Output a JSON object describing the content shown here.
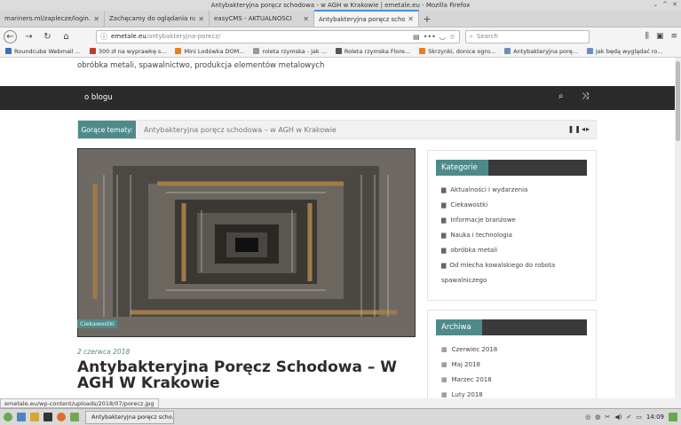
{
  "window": {
    "title": "Antybakteryjna poręcz schodowa - w AGH w Krakowie | emetale.eu - Mozilla Firefox"
  },
  "tabs": [
    {
      "label": "marinero.ml/zaplecze/login.php",
      "active": false
    },
    {
      "label": "Zachęcamy do oglądania naszej",
      "active": false
    },
    {
      "label": "easyCMS - AKTUALNOŚCI",
      "active": false
    },
    {
      "label": "Antybakteryjna poręcz schodowa",
      "active": true
    }
  ],
  "navbar": {
    "url_domain": "emetale.eu",
    "url_path": "/antybakteryjna-porecz/",
    "search_placeholder": "Search"
  },
  "bookmarks": [
    {
      "label": "Roundcube Webmail ...",
      "color": "#3a6fb5"
    },
    {
      "label": "300 zł na wyprawkę s...",
      "color": "#c0392b"
    },
    {
      "label": "Mini Lodówka DOM...",
      "color": "#e67e22"
    },
    {
      "label": "roleta rzymska - jak ...",
      "color": "#999999"
    },
    {
      "label": "Roleta rzymska Flore...",
      "color": "#555555"
    },
    {
      "label": "Skrzynki, donice ogro...",
      "color": "#e67e22"
    },
    {
      "label": "Antybakteryjna porę...",
      "color": "#6c8ebf"
    },
    {
      "label": "Jak będą wyglądać ro...",
      "color": "#6c8ebf"
    }
  ],
  "page": {
    "tagline": "obróbka metali, spawalnictwo, produkcja elementów metalowych",
    "menu_item": "o blogu",
    "hot_label": "Gorące tematy:",
    "hot_text": "Antybakteryjna poręcz schodowa – w AGH w Krakowie",
    "category_badge": "Ciekawostki",
    "post_date": "2 czerwca 2018",
    "post_title": "Antybakteryjna Poręcz Schodowa – W AGH W Krakowie"
  },
  "sidebar": {
    "categories_title": "Kategorie",
    "categories": [
      "Aktualności i wydarzenia",
      "Ciekawostki",
      "Informacje branżowe",
      "Nauka i technologia",
      "obróbka metali",
      "Od miecha kowalskiego do robota spawalniczego"
    ],
    "archive_title": "Archiwa",
    "archive": [
      "Czerwiec 2018",
      "Maj 2018",
      "Marzec 2018",
      "Luty 2018"
    ]
  },
  "status": {
    "url": "emetale.eu/wp-content/uploads/2018/07/porecz.jpg"
  },
  "taskbar": {
    "task_label": "Antybakteryjna poręcz scho...",
    "clock": "14:09"
  },
  "colors": {
    "accent": "#4f8a8b",
    "nav_dark": "#2b2b2b"
  }
}
